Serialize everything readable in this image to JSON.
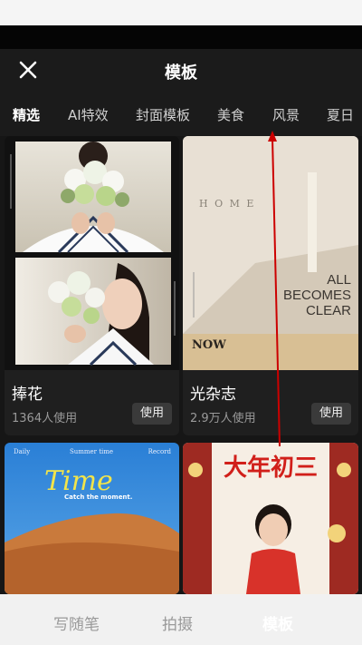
{
  "header": {
    "title": "模板"
  },
  "tabs": [
    "精选",
    "AI特效",
    "封面模板",
    "美食",
    "风景",
    "夏日"
  ],
  "cards": [
    {
      "title": "捧花",
      "uses": "1364人使用",
      "button": "使用"
    },
    {
      "title": "光杂志",
      "uses": "2.9万人使用",
      "button": "使用"
    }
  ],
  "art": {
    "home": "H  O  M  E",
    "all_becomes_clear": [
      "ALL",
      "BECOMES",
      "CLEAR"
    ],
    "now": "NOW",
    "time": "Time",
    "catch": "Catch the moment.",
    "top_row": [
      "Daily",
      "Summer time",
      "Record"
    ],
    "new_year": "大年初三"
  },
  "bottom_tabs": [
    "写随笔",
    "拍摄",
    "模板"
  ],
  "colors": {
    "accent": "#cc0000"
  }
}
